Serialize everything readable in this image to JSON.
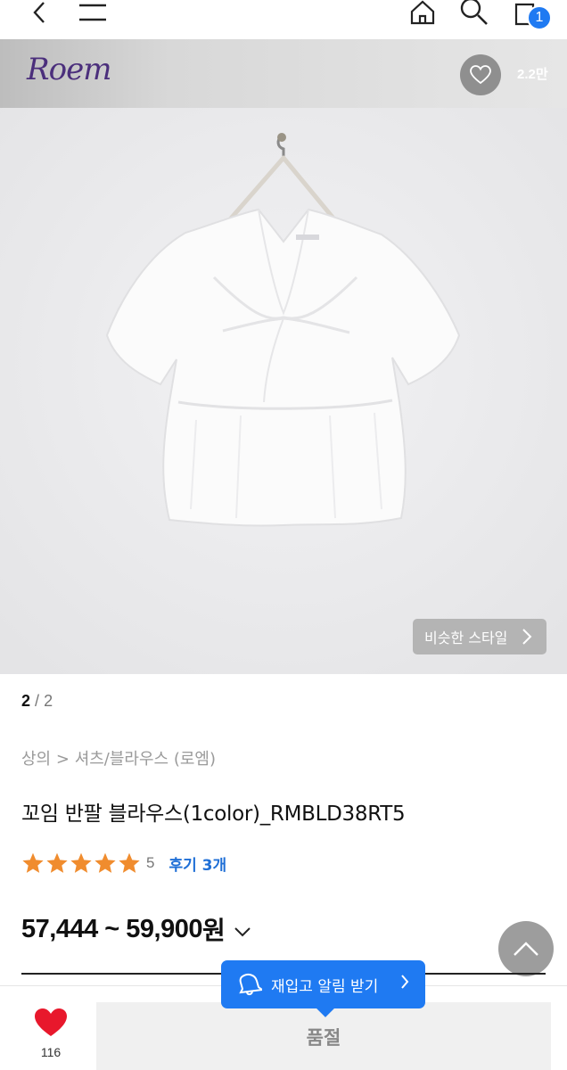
{
  "topbar": {
    "cart_count": "1"
  },
  "brand": {
    "logo_text": "Roem",
    "like_count": "2.2만"
  },
  "gallery": {
    "similar_style_label": "비슷한 스타일",
    "current_page": "2",
    "separator": "/",
    "total_pages": "2"
  },
  "breadcrumb": {
    "category": "상의",
    "sep": ">",
    "subcategory": "셔츠/블라우스 (로엠)"
  },
  "product": {
    "title": "꼬임 반팔 블라우스(1color)_RMBLD38RT5",
    "rating_stars": 5,
    "rating_score": "5",
    "review_label": "후기 3개",
    "price_range": "57,444 ~ 59,900",
    "price_unit": "원"
  },
  "restock": {
    "label": "재입고 알림 받기"
  },
  "bottom": {
    "wish_count": "116",
    "soldout_label": "품절"
  },
  "colors": {
    "accent": "#1f7af2",
    "star": "#f08c2e",
    "heart": "#e8182c"
  }
}
